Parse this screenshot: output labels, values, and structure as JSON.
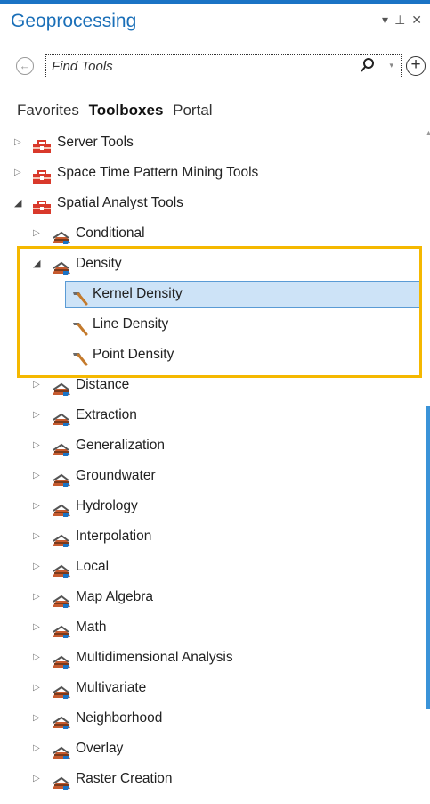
{
  "pane": {
    "title": "Geoprocessing",
    "controls": [
      "▾",
      "⊥",
      "✕"
    ]
  },
  "search": {
    "placeholder": "Find Tools",
    "value": ""
  },
  "tabs": [
    {
      "label": "Favorites",
      "active": false
    },
    {
      "label": "Toolboxes",
      "active": true
    },
    {
      "label": "Portal",
      "active": false
    }
  ],
  "colors": {
    "accent": "#1a6fb8",
    "highlight_frame": "#f5b800",
    "selection_bg": "#cde3f7",
    "selection_border": "#5a9bd5",
    "scroll_thumb": "#3a93d8"
  },
  "tree": [
    {
      "label": "Server Tools",
      "type": "toolbox",
      "level": 0,
      "expanded": false
    },
    {
      "label": "Space Time Pattern Mining Tools",
      "type": "toolbox",
      "level": 0,
      "expanded": false
    },
    {
      "label": "Spatial Analyst Tools",
      "type": "toolbox",
      "level": 0,
      "expanded": true
    },
    {
      "label": "Conditional",
      "type": "toolset",
      "level": 1,
      "expanded": false
    },
    {
      "label": "Density",
      "type": "toolset",
      "level": 1,
      "expanded": true
    },
    {
      "label": "Kernel Density",
      "type": "tool",
      "level": 2,
      "selected": true
    },
    {
      "label": "Line Density",
      "type": "tool",
      "level": 2
    },
    {
      "label": "Point Density",
      "type": "tool",
      "level": 2
    },
    {
      "label": "Distance",
      "type": "toolset",
      "level": 1,
      "expanded": false
    },
    {
      "label": "Extraction",
      "type": "toolset",
      "level": 1,
      "expanded": false
    },
    {
      "label": "Generalization",
      "type": "toolset",
      "level": 1,
      "expanded": false
    },
    {
      "label": "Groundwater",
      "type": "toolset",
      "level": 1,
      "expanded": false
    },
    {
      "label": "Hydrology",
      "type": "toolset",
      "level": 1,
      "expanded": false
    },
    {
      "label": "Interpolation",
      "type": "toolset",
      "level": 1,
      "expanded": false
    },
    {
      "label": "Local",
      "type": "toolset",
      "level": 1,
      "expanded": false
    },
    {
      "label": "Map Algebra",
      "type": "toolset",
      "level": 1,
      "expanded": false
    },
    {
      "label": "Math",
      "type": "toolset",
      "level": 1,
      "expanded": false
    },
    {
      "label": "Multidimensional Analysis",
      "type": "toolset",
      "level": 1,
      "expanded": false
    },
    {
      "label": "Multivariate",
      "type": "toolset",
      "level": 1,
      "expanded": false
    },
    {
      "label": "Neighborhood",
      "type": "toolset",
      "level": 1,
      "expanded": false
    },
    {
      "label": "Overlay",
      "type": "toolset",
      "level": 1,
      "expanded": false
    },
    {
      "label": "Raster Creation",
      "type": "toolset",
      "level": 1,
      "expanded": false
    }
  ]
}
